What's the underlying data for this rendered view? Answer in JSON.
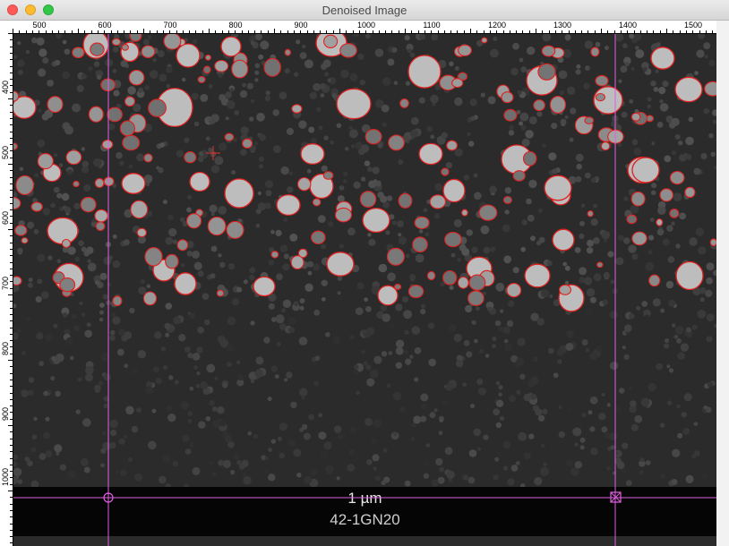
{
  "window": {
    "title": "Denoised Image",
    "buttons": {
      "close": "close-button",
      "minimize": "minimize-button",
      "zoom": "zoom-button"
    }
  },
  "rulers": {
    "x_labels": [
      "500",
      "600",
      "700",
      "800",
      "900",
      "1000",
      "1100",
      "1200",
      "1300",
      "1400",
      "1500"
    ],
    "y_labels": [
      "400",
      "500",
      "600",
      "700",
      "800",
      "900",
      "1000"
    ]
  },
  "image": {
    "scale_label": "1 µm",
    "sample_label": "42-1GN20",
    "outline_color": "#e0201e",
    "measure_line_color": "#e060e0",
    "background_color": "#2b2b2b"
  }
}
